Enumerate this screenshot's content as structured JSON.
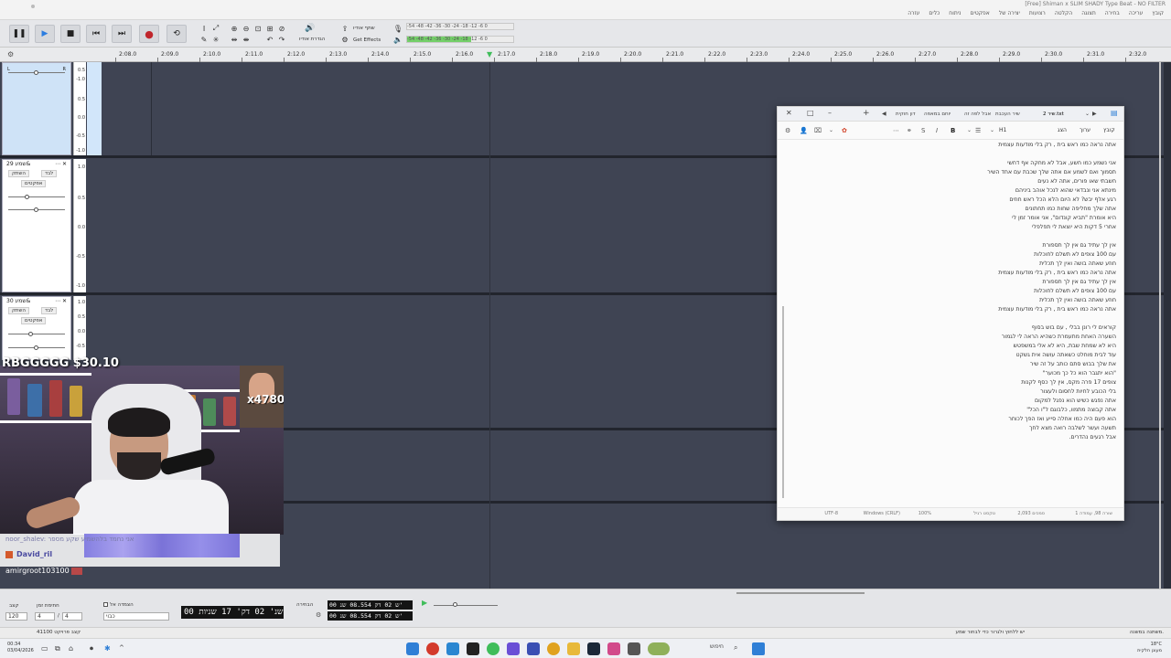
{
  "window": {
    "title": "[Free] Shiman x SLIM SHADY Type Beat - NO FILTER",
    "menus": [
      "קובץ",
      "עריכה",
      "בחירה",
      "תצוגה",
      "הקלטה",
      "רצועות",
      "יצירה של",
      "אפקטים",
      "ניתוח",
      "כלים",
      "עזרה"
    ]
  },
  "toolbar": {
    "pause_icon": "pause-icon",
    "play_icon": "play-icon",
    "stop_icon": "stop-icon",
    "skip_start_icon": "skip-start-icon",
    "skip_end_icon": "skip-end-icon",
    "record_icon": "record-icon",
    "loop_icon": "loop-icon",
    "share_label": "שתף אודיו",
    "effects_label": "Get Effects",
    "setup_label": "הגדרת אודיו",
    "meter_rec_scale": "-54 -48 -42 -36 -30 -24 -18 -12 -6 0",
    "meter_play_scale": "-54 -48 -42 -36 -30 -24 -18 -12 -6 0",
    "meter_play_level": 0.6
  },
  "ruler": {
    "ticks": [
      "2:08.0",
      "2:09.0",
      "2:10.0",
      "2:11.0",
      "2:12.0",
      "2:13.0",
      "2:14.0",
      "2:15.0",
      "2:16.0",
      "2:17.0",
      "2:18.0",
      "2:19.0",
      "2:20.0",
      "2:21.0",
      "2:22.0",
      "2:23.0",
      "2:24.0",
      "2:25.0",
      "2:26.0",
      "2:27.0",
      "2:28.0",
      "2:29.0",
      "2:30.0",
      "2:31.0",
      "2:32.0"
    ]
  },
  "tracks": [
    {
      "name": "",
      "mute": "",
      "solo": "",
      "effects": ""
    },
    {
      "name": "שמע 29&",
      "mute": "השתק",
      "solo": "לבד",
      "effects": "אפקטים"
    },
    {
      "name": "שמע 30&",
      "mute": "השתק",
      "solo": "לבד",
      "effects": "אפקטים"
    }
  ],
  "scale": [
    "1.0",
    "0.5",
    "0.0",
    "-0.5",
    "-1.0"
  ],
  "scale_short": [
    "0.5",
    "-1.0",
    "0.5",
    "0.0",
    "-0.5",
    "-1.0"
  ],
  "notepad": {
    "tabs": [
      "שיר 2.txt",
      "שיר העכבת",
      "אבל לפה זה",
      "יוחם במאפה",
      "דון חוקית"
    ],
    "menu": [
      "קובץ",
      "ערוך",
      "הצג"
    ],
    "heading_btn": "H1",
    "paragraphs": [
      [
        "אתה נראה כמו ראש בית , רק בלי מודעות עצמית"
      ],
      [
        "אני נשמע כמו חשע, אבל לא מחקה אף דחשי",
        "תסמוך ואם לשמע אם אתה שלך שכבת עם אחד השיר",
        "חשבתי שאו פורים, אתה לא נעים",
        "מינתא אני ונבדאי שהוא לנכל אוהב ביניהם",
        "רגע אלף יבש? לא היום הלא הכל ראש חוזים",
        "אתה שלך מחליפה שחות כמו תחתונים",
        "היא אומרת \"תביא קונדום\", אני אומר זמן לי",
        "אחרי 5 דקות היא יוצאת לי תפלפלי"
      ],
      [
        "אין לך עתיד גם אין לך תספורת",
        "עם 100 צופים לא תשלם לחוכלות",
        "חוזע שאתה בושה ואין לך תכלית",
        "אתה נראה כמו ראש בית , רק בלי מודעות עצמית",
        "אין לך עתיד גם אין לך תספורת",
        "עם 100 צופים לא תשלם לחוכלות",
        "חוזע שאתה בושה ואין לך תכלית",
        "אתה נראה כמו ראש בית , רק בלי מודעות עצמית"
      ],
      [
        "קוראים לי רונן בבלי , עם בוש בסוף",
        "השערה האחת מתעמרת כשהיא הראה לי לגמור",
        "היא לא שמחת שבת, היא לא אלי במשפטש",
        "עוד לבית מוחלט כשאתה עושה אית גשקט",
        "את שלך בבוש סתם כותב על זה שיר",
        "\"הוא יתגבר הוא כל כך מכוער\"",
        "צופים 17 פרה מקס, אין לך כסף לקנות",
        "בלי הכובע לחיות לחסום ולעצור",
        "אתה נפגש כשיש הוא נפגל למקום",
        "אתה קבוצה מתמוו, כלבוגם ל\"ו הכל\"",
        "הוא פעם היה כמו אחלה סייע ואז הפך לכוחר",
        "תשעה ועשר לשלבה רואה מצא לחך",
        "אבל רגעים נהדרים."
      ]
    ],
    "status": [
      "שורה 98, עמודה 1",
      "סמכים 2,093",
      "טקסט רגיל",
      "100%",
      "Windows (CRLF)",
      "UTF-8"
    ]
  },
  "stream": {
    "overlay_count": "RBGGGGG $30.10",
    "pip_label": "x4780",
    "chat_line1": "noor_shalev: אני נחמד בלהשמיע שקע מספר",
    "chat_line2": "David_ril",
    "chat_user": "amirgroot103100"
  },
  "selection": {
    "rate_label": "קצב",
    "rate_value": "120",
    "time_sig_label": "חתימת זמן",
    "time_sig_num": "4",
    "time_sig_den": "4",
    "snap_label": "הצמדה אל",
    "snap_value": "כבוי",
    "main_time": "00 שנ' 02 דק' 17 שניות",
    "sel_label": "הבחירה",
    "sel_start": "00 ש 02 דק 08.554 שנ'",
    "sel_end": "00 ש 02 דק 08.554 שנ'"
  },
  "statusbar": {
    "left": "41100 קצב פרויקט",
    "right_hint": "יש ללחוץ ולגרור כדי לבחור שמע",
    "right_state": "משתנה במשנה."
  },
  "taskbar": {
    "time": "00:34",
    "date": "03/04/2026",
    "search": "חיפוש",
    "weather_temp": "18°C",
    "weather_desc": "מעונן חלקית"
  }
}
